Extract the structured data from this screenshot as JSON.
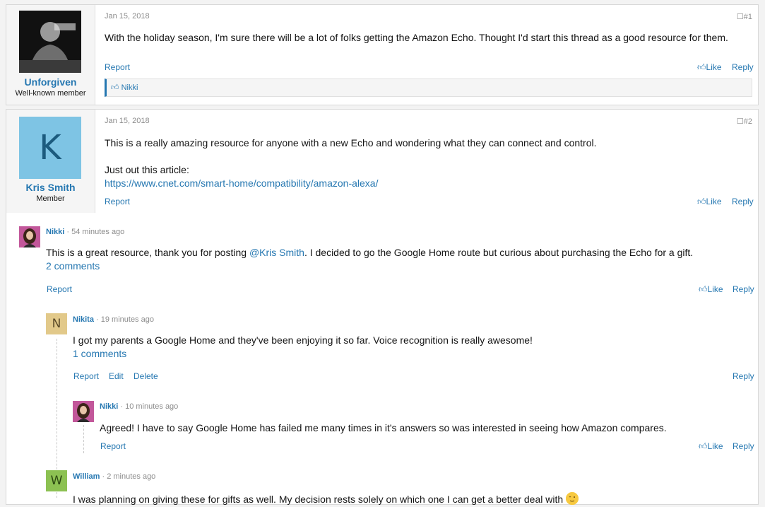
{
  "posts": [
    {
      "username": "Unforgiven",
      "usertitle": "Well-known member",
      "date": "Jan 15, 2018",
      "number": "#1",
      "text": "With the holiday season, I'm sure there will be a lot of folks getting the Amazon Echo. Thought I'd start this thread as a good resource for them.",
      "report": "Report",
      "like": "Like",
      "reply": "Reply",
      "liked_by": "Nikki"
    },
    {
      "username": "Kris Smith",
      "usertitle": "Member",
      "avatar_letter": "K",
      "avatar_color": "#7ec4e4",
      "date": "Jan 15, 2018",
      "number": "#2",
      "text": "This is a really amazing resource for anyone with a new Echo and wondering what they can connect and control.",
      "text2": "Just out this article:",
      "link": "https://www.cnet.com/smart-home/compatibility/amazon-alexa/",
      "report": "Report",
      "like": "Like",
      "reply": "Reply"
    }
  ],
  "comments": [
    {
      "author": "Nikki",
      "time": "· 54 minutes ago",
      "text_before": "This is a great resource, thank you for posting ",
      "mention": "@Kris Smith",
      "text_after": ". I decided to go the Google Home route but curious about purchasing the Echo for a gift.",
      "comments_link": "2 comments",
      "report": "Report",
      "like": "Like",
      "reply": "Reply"
    },
    {
      "author": "Nikita",
      "time": "· 19 minutes ago",
      "avatar_letter": "N",
      "avatar_color": "#e2c98a",
      "text": "I got my parents a Google Home and they've been enjoying it so far. Voice recognition is really awesome!",
      "comments_link": "1 comments",
      "report": "Report",
      "edit": "Edit",
      "delete": "Delete",
      "reply": "Reply"
    },
    {
      "author": "Nikki",
      "time": "· 10 minutes ago",
      "text": "Agreed! I have to say Google Home has failed me many times in it's answers so was interested in seeing how Amazon compares.",
      "report": "Report",
      "like": "Like",
      "reply": "Reply"
    },
    {
      "author": "William",
      "time": "· 2 minutes ago",
      "avatar_letter": "W",
      "avatar_color": "#8cc152",
      "text": "I was planning on giving these for gifts as well. My decision rests solely on which one I can get a better deal with"
    }
  ],
  "colors": {
    "link": "#2577b1",
    "muted": "#8c8c8c"
  }
}
